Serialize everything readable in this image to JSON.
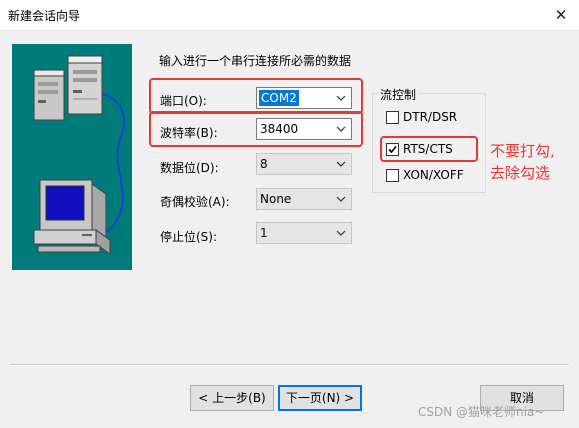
{
  "window": {
    "title": "新建会话向导",
    "close_label": "✕"
  },
  "wizard": {
    "instruction": "输入进行一个串行连接所必需的数据"
  },
  "fields": {
    "port": {
      "label": "端口(O):",
      "value": "COM2"
    },
    "baud": {
      "label": "波特率(B):",
      "value": "38400"
    },
    "data_bits": {
      "label": "数据位(D):",
      "value": "8"
    },
    "parity": {
      "label": "奇偶校验(A):",
      "value": "None"
    },
    "stop_bits": {
      "label": "停止位(S):",
      "value": "1"
    }
  },
  "flow_control": {
    "label": "流控制",
    "options": [
      {
        "label": "DTR/DSR",
        "checked": false
      },
      {
        "label": "RTS/CTS",
        "checked": true
      },
      {
        "label": "XON/XOFF",
        "checked": false
      }
    ]
  },
  "annotation": {
    "line1": "不要打勾,",
    "line2": "去除勾选",
    "color": "#e53935"
  },
  "buttons": {
    "back": "< 上一步(B)",
    "next": "下一页(N) >",
    "cancel": "取消"
  },
  "watermark": "CSDN @猫咪老师nia~",
  "colors": {
    "illustration_bg": "#007b7b",
    "accent": "#0078d7",
    "highlight_red": "#e53935"
  }
}
